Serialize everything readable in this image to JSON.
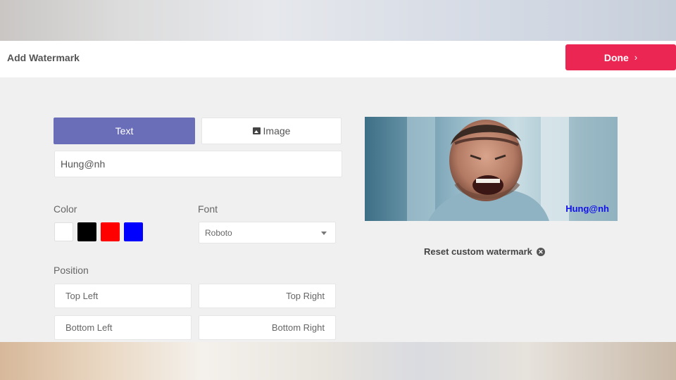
{
  "header": {
    "title": "Add Watermark",
    "done_label": "Done",
    "done_chevron": "›",
    "accent_color": "#ec2653"
  },
  "tabs": {
    "text_label": "Text",
    "image_label": "Image",
    "active": "Text",
    "active_color": "#6a6eb8",
    "image_icon": "image-icon"
  },
  "watermark_input": {
    "value": "Hung@nh"
  },
  "color": {
    "label": "Color",
    "swatches": [
      "#ffffff",
      "#000000",
      "#ff0000",
      "#0000ff"
    ]
  },
  "font": {
    "label": "Font",
    "selected": "Roboto"
  },
  "position": {
    "label": "Position",
    "options": {
      "top_left": "Top Left",
      "top_right": "Top Right",
      "bottom_left": "Bottom Left",
      "bottom_right": "Bottom Right"
    }
  },
  "preview": {
    "watermark_text": "Hung@nh",
    "watermark_color": "#1212e8"
  },
  "reset": {
    "label": "Reset custom watermark",
    "icon": "close-circle-icon"
  }
}
